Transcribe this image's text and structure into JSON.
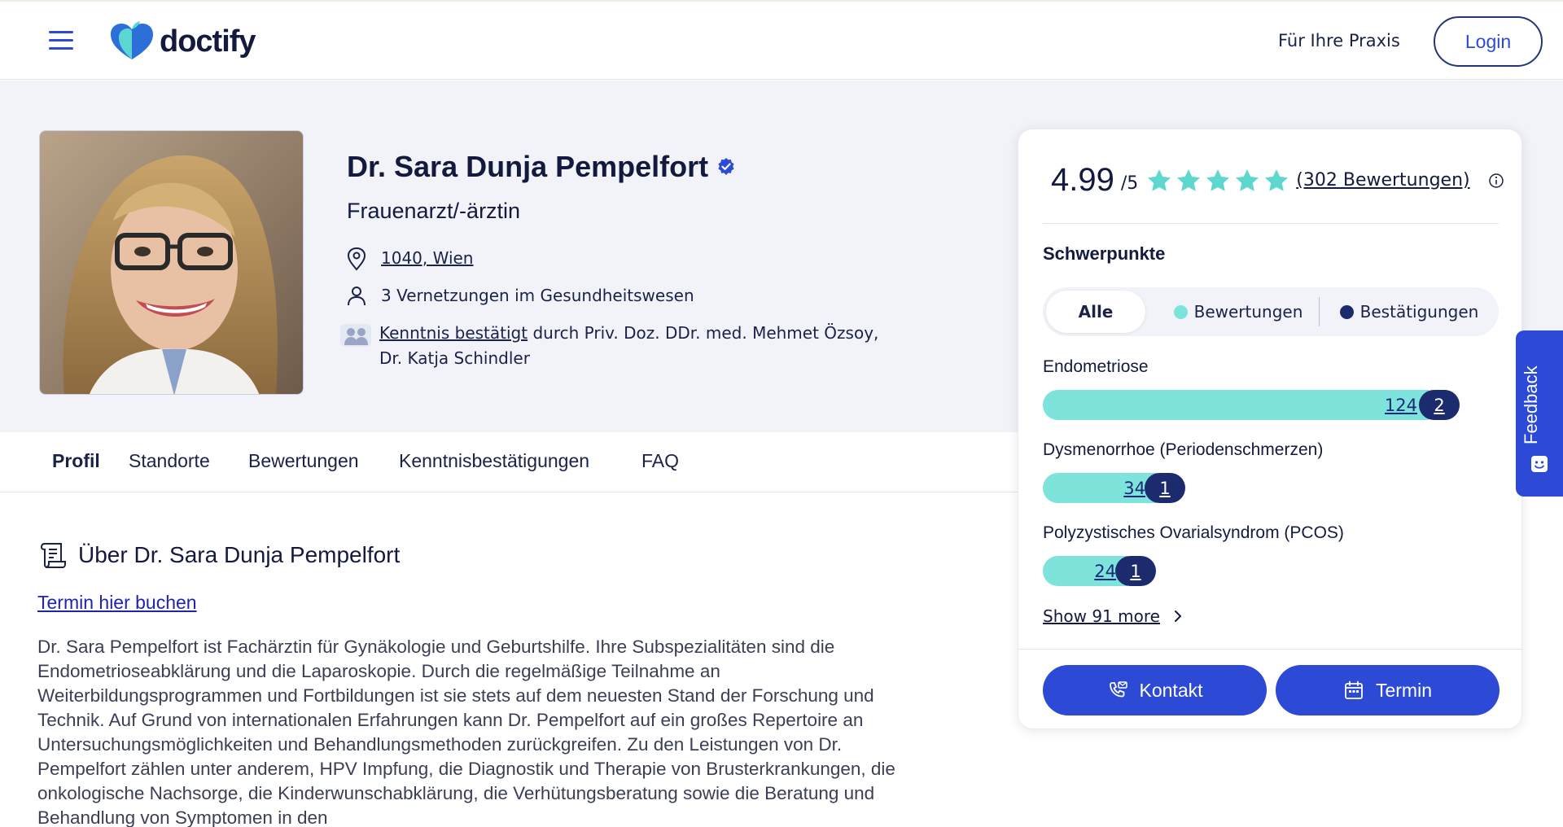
{
  "header": {
    "logo_text": "doctify",
    "praxis_link": "Für Ihre Praxis",
    "login_label": "Login"
  },
  "profile": {
    "name": "Dr. Sara Dunja Pempelfort",
    "specialty": "Frauenarzt/-ärztin",
    "location": "1040, Wien",
    "connections": "3 Vernetzungen im Gesundheitswesen",
    "endorsement_link": "Kenntnis bestätigt",
    "endorsement_text": " durch Priv. Doz. DDr. med. Mehmet Özsoy, Dr. Katja Schindler"
  },
  "tabs": [
    {
      "label": "Profil",
      "active": true
    },
    {
      "label": "Standorte"
    },
    {
      "label": "Bewertungen"
    },
    {
      "label": "Kenntnisbestätigungen"
    },
    {
      "label": "FAQ"
    }
  ],
  "about": {
    "title": "Über Dr. Sara Dunja Pempelfort",
    "book_link": "Termin hier buchen",
    "text": "Dr. Sara Pempelfort ist Fachärztin für Gynäkologie und Geburtshilfe. Ihre Subspezialitäten sind die Endometrioseabklärung und die Laparoskopie. Durch die regelmäßige Teilnahme an Weiterbildungsprogrammen und Fortbildungen ist sie stets auf dem neuesten Stand der Forschung und Technik. Auf Grund von internationalen Erfahrungen kann Dr. Pempelfort auf ein großes Repertoire an Untersuchungsmöglichkeiten und Behandlungsmethoden zurückgreifen. Zu den Leistungen von Dr. Pempelfort zählen unter anderem, HPV Impfung, die Diagnostik und Therapie von Brusterkrankungen, die onkologische Nachsorge, die Kinderwunschabklärung, die Verhütungsberatung sowie die Beratung und Behandlung von Symptomen in den"
  },
  "rating": {
    "score": "4.99",
    "out_of": "/5",
    "stars": 5,
    "reviews_link": "(302 Bewertungen)"
  },
  "schwerpunkte": {
    "title": "Schwerpunkte",
    "filters": {
      "all": "Alle",
      "reviews": "Bewertungen",
      "confirmations": "Bestätigungen"
    },
    "items": [
      {
        "label": "Endometriose",
        "reviews": "124",
        "confirmations": "2"
      },
      {
        "label": "Dysmenorrhoe (Periodenschmerzen)",
        "reviews": "34",
        "confirmations": "1"
      },
      {
        "label": "Polyzystisches Ovarialsyndrom (PCOS)",
        "reviews": "24",
        "confirmations": "1"
      }
    ],
    "show_more": "Show 91 more"
  },
  "actions": {
    "contact": "Kontakt",
    "appointment": "Termin"
  },
  "feedback_label": "Feedback",
  "colors": {
    "primary": "#2c4ad6",
    "navy": "#1c2a6e",
    "teal": "#7ee3da",
    "text": "#131a3e"
  }
}
